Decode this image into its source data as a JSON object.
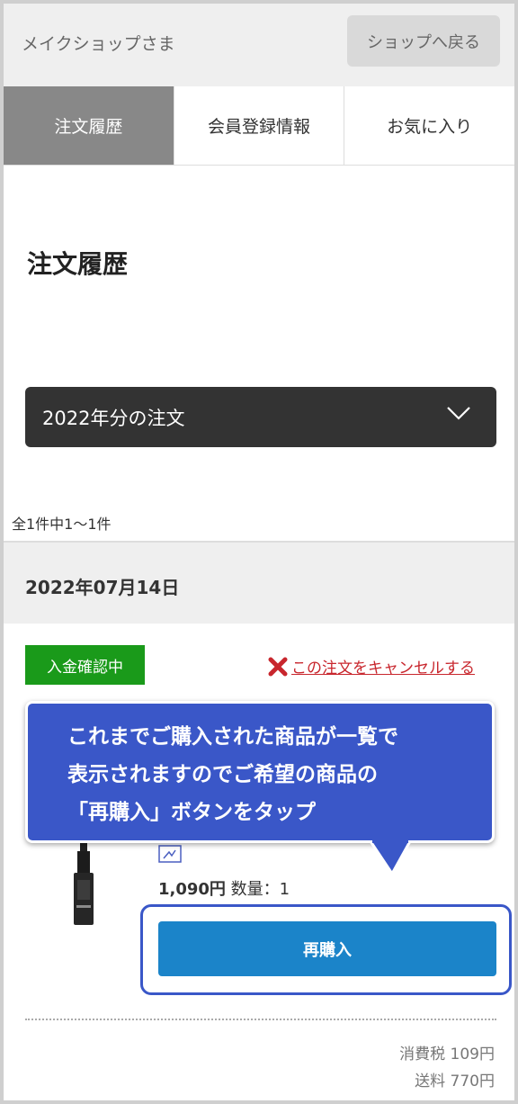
{
  "header": {
    "greeting": "メイクショップさま",
    "back_label": "ショップへ戻る"
  },
  "tabs": [
    {
      "label": "注文履歴",
      "active": true
    },
    {
      "label": "会員登録情報",
      "active": false
    },
    {
      "label": "お気に入り",
      "active": false
    }
  ],
  "page_title": "注文履歴",
  "year_filter": {
    "selected": "2022年分の注文",
    "icon": "chevron-down-icon"
  },
  "result_count": "全1件中1～1件",
  "order": {
    "date": "2022年07月14日",
    "status": "入金確認中",
    "cancel_label": "この注文をキャンセルする",
    "price": "1,090円",
    "quantity_label": "数量：1",
    "rebuy_label": "再購入",
    "tax_label": "消費税 109円",
    "shipping_label": "送料 770円"
  },
  "tooltip": {
    "lines": [
      "これまでご購入された商品が一覧で",
      "表示されますのでご希望の商品の",
      "「再購入」ボタンをタップ"
    ]
  },
  "colors": {
    "active_tab": "#888888",
    "status_green": "#1a9a1a",
    "cancel_red": "#c8262d",
    "tooltip_blue": "#3a57c8",
    "rebuy_blue": "#1b84c9"
  }
}
